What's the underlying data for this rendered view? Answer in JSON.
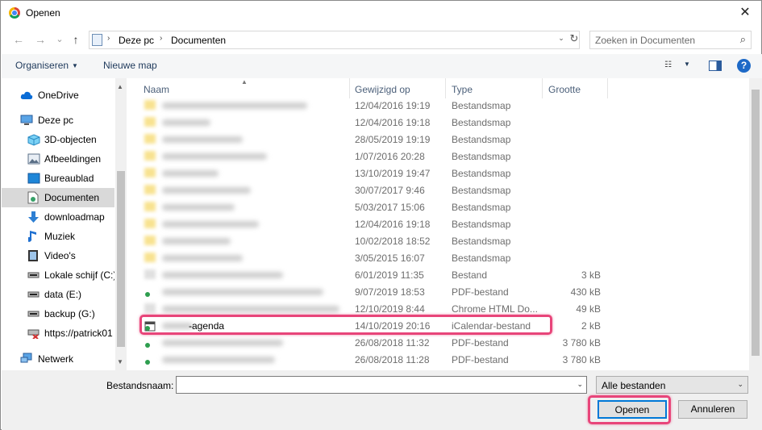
{
  "window": {
    "title": "Openen",
    "close_icon": "close-icon"
  },
  "nav_buttons": {
    "back": "←",
    "forward": "→",
    "recent": "⌄",
    "up": "↑"
  },
  "breadcrumb": {
    "items": [
      "Deze pc",
      "Documenten"
    ],
    "separator": "›"
  },
  "search": {
    "placeholder": "Zoeken in Documenten",
    "icon": "search-icon"
  },
  "toolbar": {
    "organize": "Organiseren",
    "new_folder": "Nieuwe map"
  },
  "sidebar": {
    "items": [
      {
        "label": "OneDrive",
        "icon": "cloud-icon"
      },
      {
        "label": "Deze pc",
        "icon": "computer-icon"
      },
      {
        "label": "3D-objecten",
        "icon": "cube-icon"
      },
      {
        "label": "Afbeeldingen",
        "icon": "pictures-icon"
      },
      {
        "label": "Bureaublad",
        "icon": "desktop-icon"
      },
      {
        "label": "Documenten",
        "icon": "documents-icon",
        "selected": true
      },
      {
        "label": "downloadmap",
        "icon": "download-icon"
      },
      {
        "label": "Muziek",
        "icon": "music-icon"
      },
      {
        "label": "Video's",
        "icon": "video-icon"
      },
      {
        "label": "Lokale schijf (C:)",
        "icon": "drive-icon"
      },
      {
        "label": "data (E:)",
        "icon": "drive-icon"
      },
      {
        "label": "backup (G:)",
        "icon": "drive-icon"
      },
      {
        "label": "https://patrick01",
        "icon": "network-drive-disconnected-icon"
      },
      {
        "label": "Netwerk",
        "icon": "network-icon"
      }
    ]
  },
  "columns": {
    "name": "Naam",
    "modified": "Gewijzigd op",
    "type": "Type",
    "size": "Grootte"
  },
  "files": [
    {
      "name": "",
      "modified": "12/04/2016 19:19",
      "type": "Bestandsmap",
      "size": ""
    },
    {
      "name": "",
      "modified": "12/04/2016 19:18",
      "type": "Bestandsmap",
      "size": ""
    },
    {
      "name": "",
      "modified": "28/05/2019 19:19",
      "type": "Bestandsmap",
      "size": ""
    },
    {
      "name": "",
      "modified": "1/07/2016 20:28",
      "type": "Bestandsmap",
      "size": ""
    },
    {
      "name": "",
      "modified": "13/10/2019 19:47",
      "type": "Bestandsmap",
      "size": ""
    },
    {
      "name": "",
      "modified": "30/07/2017 9:46",
      "type": "Bestandsmap",
      "size": ""
    },
    {
      "name": "",
      "modified": "5/03/2017 15:06",
      "type": "Bestandsmap",
      "size": ""
    },
    {
      "name": "",
      "modified": "12/04/2016 19:18",
      "type": "Bestandsmap",
      "size": ""
    },
    {
      "name": "",
      "modified": "10/02/2018 18:52",
      "type": "Bestandsmap",
      "size": ""
    },
    {
      "name": "",
      "modified": "3/05/2015 16:07",
      "type": "Bestandsmap",
      "size": ""
    },
    {
      "name": "",
      "modified": "6/01/2019 11:35",
      "type": "Bestand",
      "size": "3 kB"
    },
    {
      "name": "",
      "modified": "9/07/2019 18:53",
      "type": "PDF-bestand",
      "size": "430 kB"
    },
    {
      "name": "",
      "modified": "12/10/2019 8:44",
      "type": "Chrome HTML Do...",
      "size": "49 kB"
    },
    {
      "name": "-agenda",
      "modified": "14/10/2019 20:16",
      "type": "iCalendar-bestand",
      "size": "2 kB",
      "highlighted": true
    },
    {
      "name": "",
      "modified": "26/08/2018 11:32",
      "type": "PDF-bestand",
      "size": "3 780 kB"
    },
    {
      "name": "",
      "modified": "26/08/2018 11:28",
      "type": "PDF-bestand",
      "size": "3 780 kB"
    }
  ],
  "bottom": {
    "filename_label": "Bestandsnaam:",
    "filename_value": "",
    "filter": "Alle bestanden",
    "open": "Openen",
    "cancel": "Annuleren"
  },
  "colors": {
    "highlight": "#e8457a",
    "selected_nav": "#d9d9d9",
    "primary_border": "#0078d7",
    "toolbar_text": "#1e395b"
  }
}
